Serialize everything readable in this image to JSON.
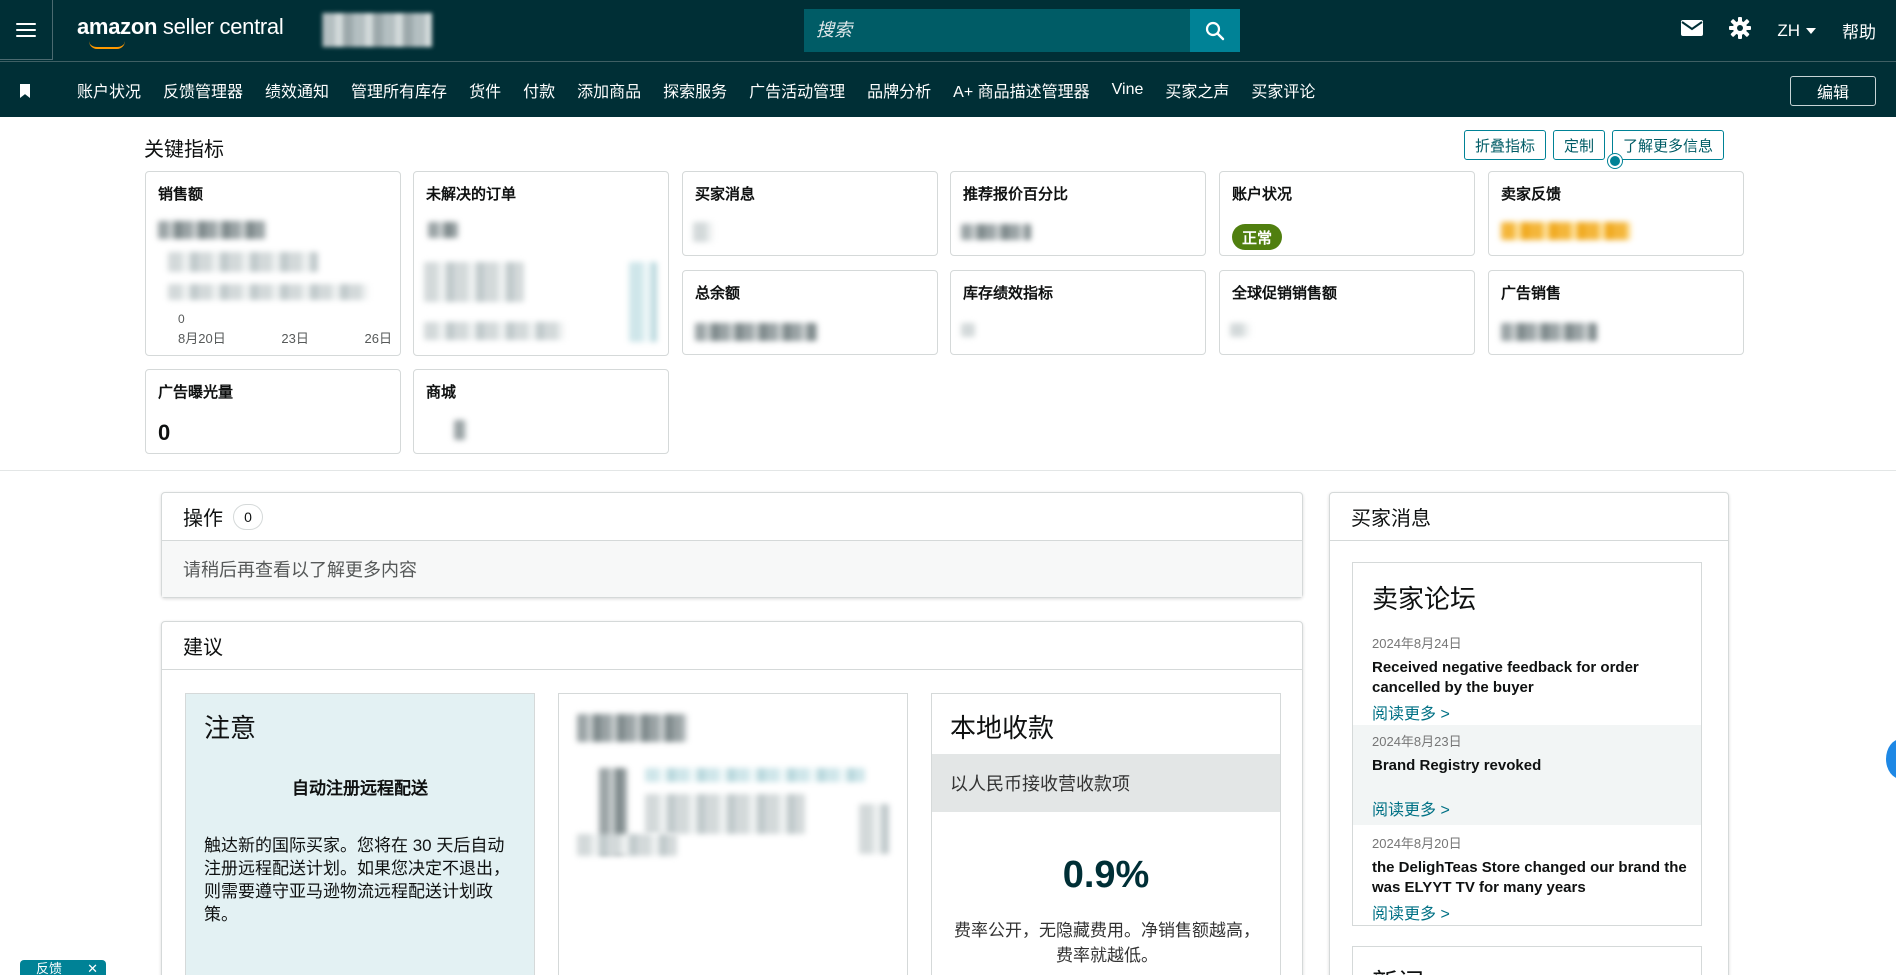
{
  "header": {
    "logo_text_bold": "amazon",
    "logo_text": " seller central",
    "search_placeholder": "搜索",
    "language": "ZH",
    "help": "帮助"
  },
  "nav": {
    "items": [
      "账户状况",
      "反馈管理器",
      "绩效通知",
      "管理所有库存",
      "货件",
      "付款",
      "添加商品",
      "探索服务",
      "广告活动管理",
      "品牌分析",
      "A+ 商品描述管理器",
      "Vine",
      "买家之声",
      "买家评论"
    ],
    "edit": "编辑"
  },
  "key_metrics": {
    "title": "关键指标",
    "buttons": [
      "折叠指标",
      "定制",
      "了解更多信息"
    ],
    "cards": {
      "sales": "销售额",
      "open_orders": "未解决的订单",
      "buyer_messages": "买家消息",
      "featured_offer": "推荐报价百分比",
      "account_health": "账户状况",
      "account_health_status": "正常",
      "seller_feedback": "卖家反馈",
      "total_balance": "总余额",
      "inventory_perf": "库存绩效指标",
      "global_promo": "全球促销销售额",
      "ad_sales": "广告销售",
      "ad_impressions": "广告曝光量",
      "ad_impressions_value": "0",
      "store": "商城"
    },
    "sales_axis": [
      "8月20日",
      "23日",
      "26日"
    ],
    "sales_axis_zero": "0"
  },
  "operations": {
    "title": "操作",
    "count": "0",
    "empty_text": "请稍后再查看以了解更多内容"
  },
  "recommendations": {
    "title": "建议",
    "note_title": "注意",
    "note_subtitle": "自动注册远程配送",
    "note_text": "触达新的国际买家。您将在 30 天后自动注册远程配送计划。如果您决定不退出，则需要遵守亚马逊物流远程配送计划政策。",
    "local_title": "本地收款",
    "local_band": "以人民币接收营收款项",
    "local_rate": "0.9%",
    "local_desc": "费率公开，无隐藏费用。净销售额越高，费率就越低。"
  },
  "buyer_messages_panel": {
    "title": "买家消息",
    "forum_title": "卖家论坛",
    "posts": [
      {
        "date": "2024年8月24日",
        "title": "Received negative feedback for order cancelled by the buyer",
        "link": "阅读更多 >"
      },
      {
        "date": "2024年8月23日",
        "title": "Brand Registry revoked",
        "link": "阅读更多 >"
      },
      {
        "date": "2024年8月20日",
        "title": "the DelighTeas Store changed our brand the was ELYYT TV for many years",
        "link": "阅读更多 >"
      }
    ],
    "news_title": "新闻"
  },
  "feedback_tab": "反馈",
  "colors": {
    "header_bg": "#002f36",
    "search_bg": "#005c66",
    "accent": "#008296",
    "status_green": "#507f0f",
    "link": "#007185"
  }
}
